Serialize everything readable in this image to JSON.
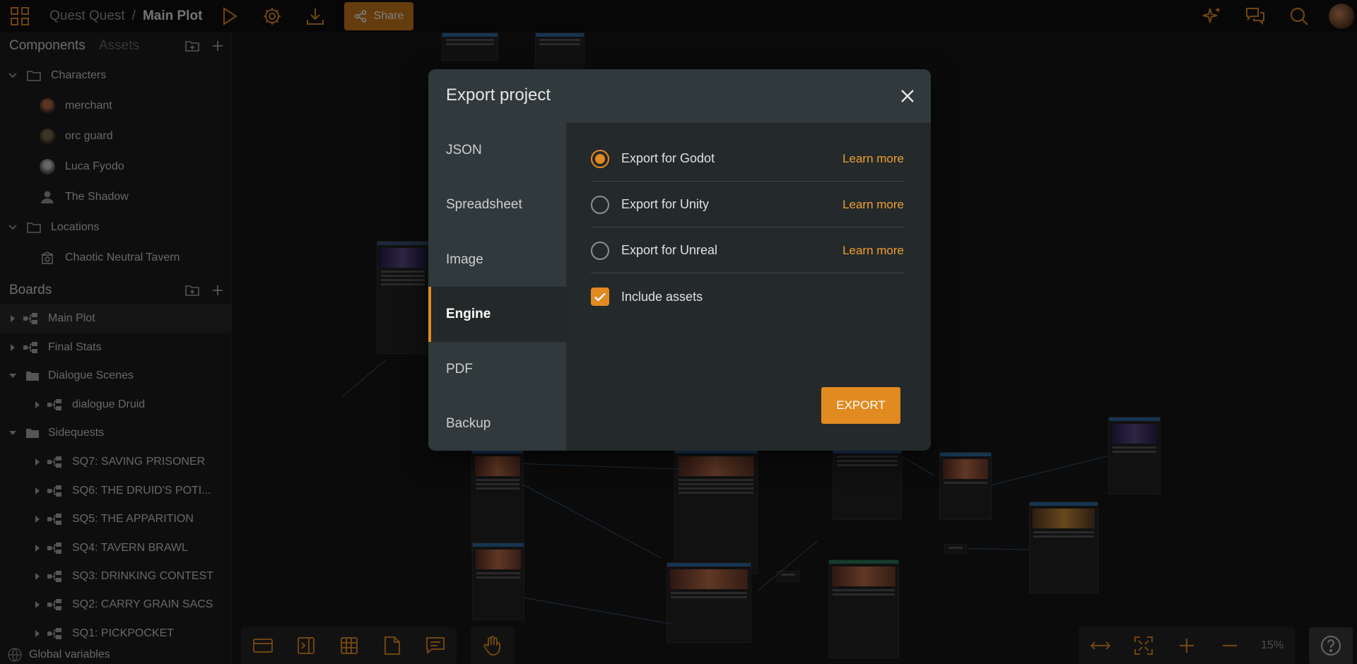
{
  "topbar": {
    "project": "Quest Quest",
    "separator": "/",
    "board": "Main Plot",
    "share_label": "Share"
  },
  "sidebar": {
    "components_tab": "Components",
    "assets_tab": "Assets",
    "components": [
      {
        "label": "Characters",
        "type": "folder"
      },
      {
        "label": "merchant",
        "type": "character"
      },
      {
        "label": "orc guard",
        "type": "character"
      },
      {
        "label": "Luca Fyodo",
        "type": "character"
      },
      {
        "label": "The Shadow",
        "type": "character"
      },
      {
        "label": "Locations",
        "type": "folder"
      },
      {
        "label": "Chaotic Neutral Tavern",
        "type": "location"
      }
    ],
    "boards_title": "Boards",
    "boards": [
      {
        "label": "Main Plot"
      },
      {
        "label": "Final Stats"
      },
      {
        "label": "Dialogue Scenes"
      },
      {
        "label": "dialogue Druid"
      },
      {
        "label": "Sidequests"
      },
      {
        "label": "SQ7: SAVING PRISONER"
      },
      {
        "label": "SQ6: THE DRUID'S POTI..."
      },
      {
        "label": "SQ5: THE APPARITION"
      },
      {
        "label": "SQ4: TAVERN BRAWL"
      },
      {
        "label": "SQ3: DRINKING CONTEST"
      },
      {
        "label": "SQ2: CARRY GRAIN SACS"
      },
      {
        "label": "SQ1: PICKPOCKET"
      }
    ],
    "global_variables": "Global variables"
  },
  "canvas": {
    "zoom": "15%"
  },
  "modal": {
    "title": "Export project",
    "tabs": [
      "JSON",
      "Spreadsheet",
      "Image",
      "Engine",
      "PDF",
      "Backup"
    ],
    "active_tab": "Engine",
    "options": [
      {
        "label": "Export for Godot",
        "link": "Learn more",
        "selected": true
      },
      {
        "label": "Export for Unity",
        "link": "Learn more",
        "selected": false
      },
      {
        "label": "Export for Unreal",
        "link": "Learn more",
        "selected": false
      }
    ],
    "include_assets": {
      "label": "Include assets",
      "checked": true
    },
    "export_label": "EXPORT"
  },
  "colors": {
    "accent": "#e18a20",
    "share_bg": "#c8791a",
    "link": "#f0a030"
  }
}
